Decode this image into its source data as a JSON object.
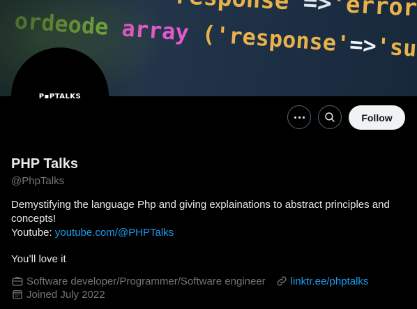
{
  "banner": {
    "code_line_1": [
      "'response'",
      "=>",
      "'error', 'mes"
    ],
    "code_line_2": [
      "ordeode",
      "array",
      "('response'",
      "=>",
      "'success');"
    ]
  },
  "avatar": {
    "logo_text": "P▪PTALKS"
  },
  "actions": {
    "follow_label": "Follow"
  },
  "profile": {
    "name": "PHP Talks",
    "handle": "@PhpTalks",
    "bio_line_1": "Demystifying the language Php and giving explainations to abstract principles and concepts!",
    "youtube_label": "Youtube:",
    "youtube_link": "youtube.com/@PHPTalks",
    "bio_line_3": "You’ll love it",
    "profession": "Software developer/Programmer/Software engineer",
    "website": "linktr.ee/phptalks",
    "joined": "Joined July 2022"
  },
  "colors": {
    "accent": "#1d9bf0",
    "muted": "#71767b",
    "text": "#e7e9ea"
  }
}
